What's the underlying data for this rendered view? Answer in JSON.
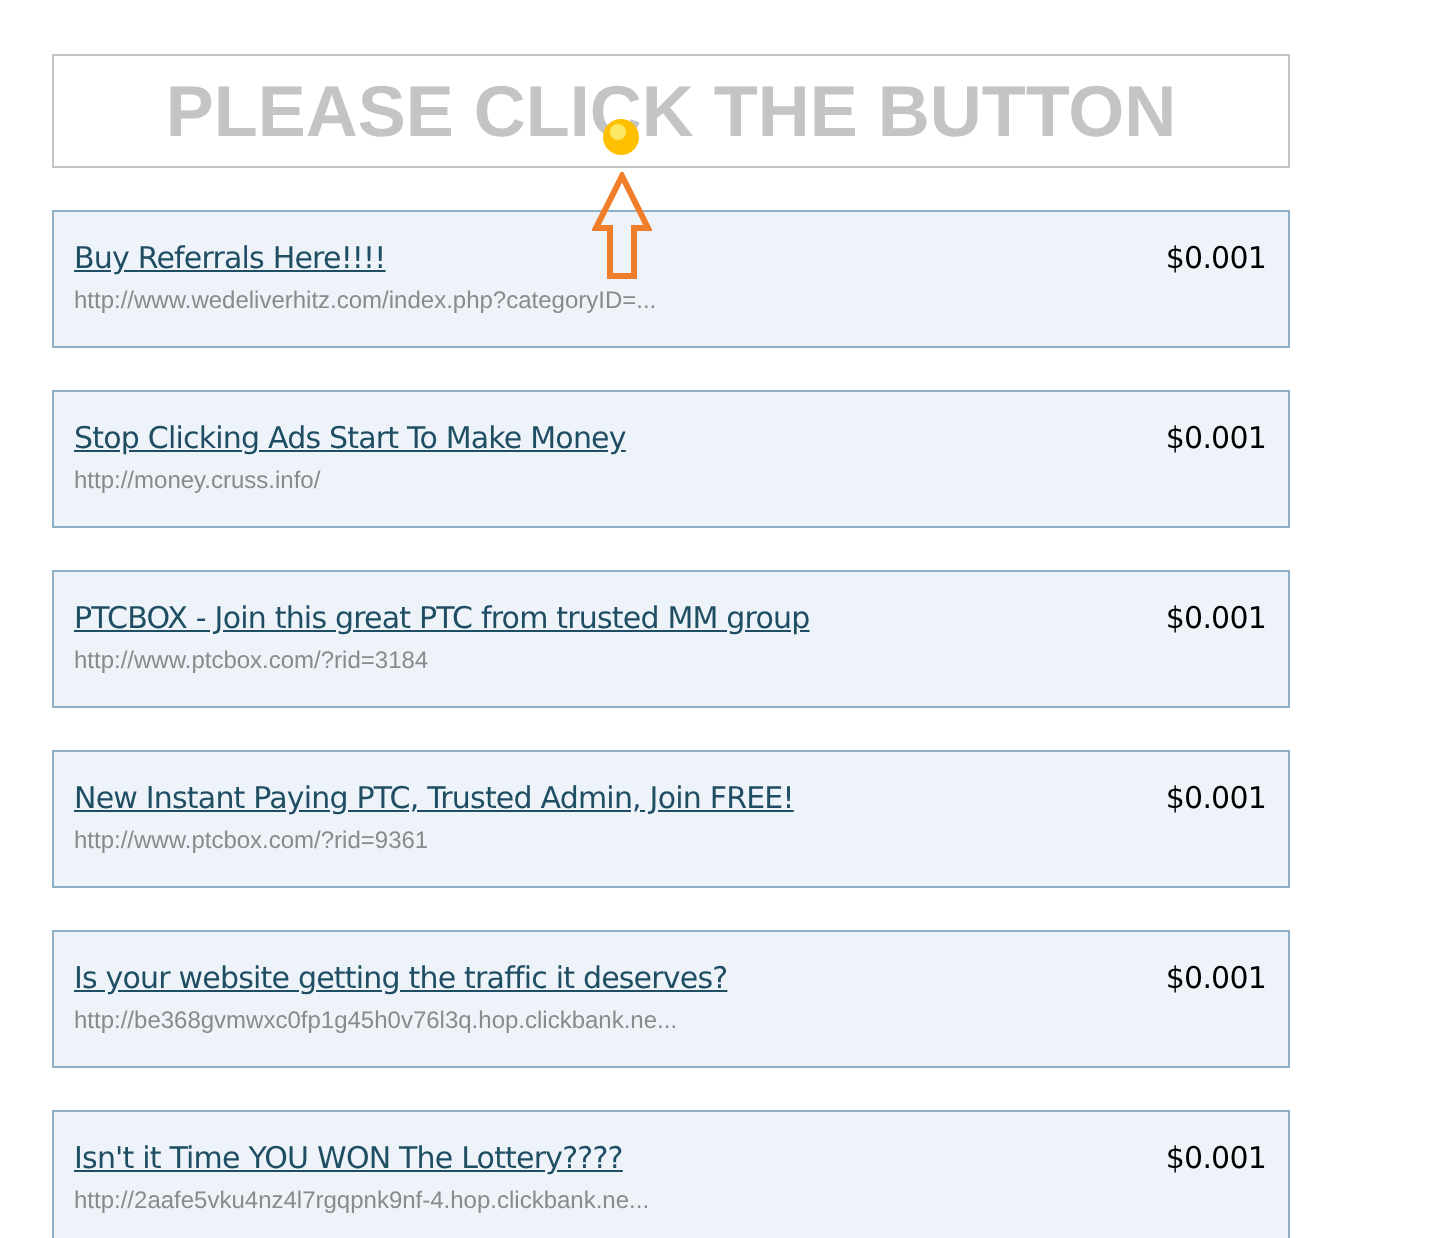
{
  "banner": {
    "text": "PLEASE CLICK THE BUTTON"
  },
  "ads": [
    {
      "title": "Buy Referrals Here!!!!",
      "url": "http://www.wedeliverhitz.com/index.php?categoryID=...",
      "price": "$0.001"
    },
    {
      "title": "Stop Clicking Ads Start To Make Money",
      "url": "http://money.cruss.info/",
      "price": "$0.001"
    },
    {
      "title": "PTCBOX - Join this great PTC from trusted MM group",
      "url": "http://www.ptcbox.com/?rid=3184",
      "price": "$0.001"
    },
    {
      "title": "New Instant Paying PTC, Trusted Admin, Join FREE!",
      "url": "http://www.ptcbox.com/?rid=9361",
      "price": "$0.001"
    },
    {
      "title": "Is your website getting the traffic it deserves?",
      "url": "http://be368gvmwxc0fp1g45h0v76l3q.hop.clickbank.ne...",
      "price": "$0.001"
    },
    {
      "title": "Isn't it Time YOU WON The Lottery????",
      "url": "http://2aafe5vku4nz4l7rgqpnk9nf-4.hop.clickbank.ne...",
      "price": "$0.001"
    }
  ]
}
